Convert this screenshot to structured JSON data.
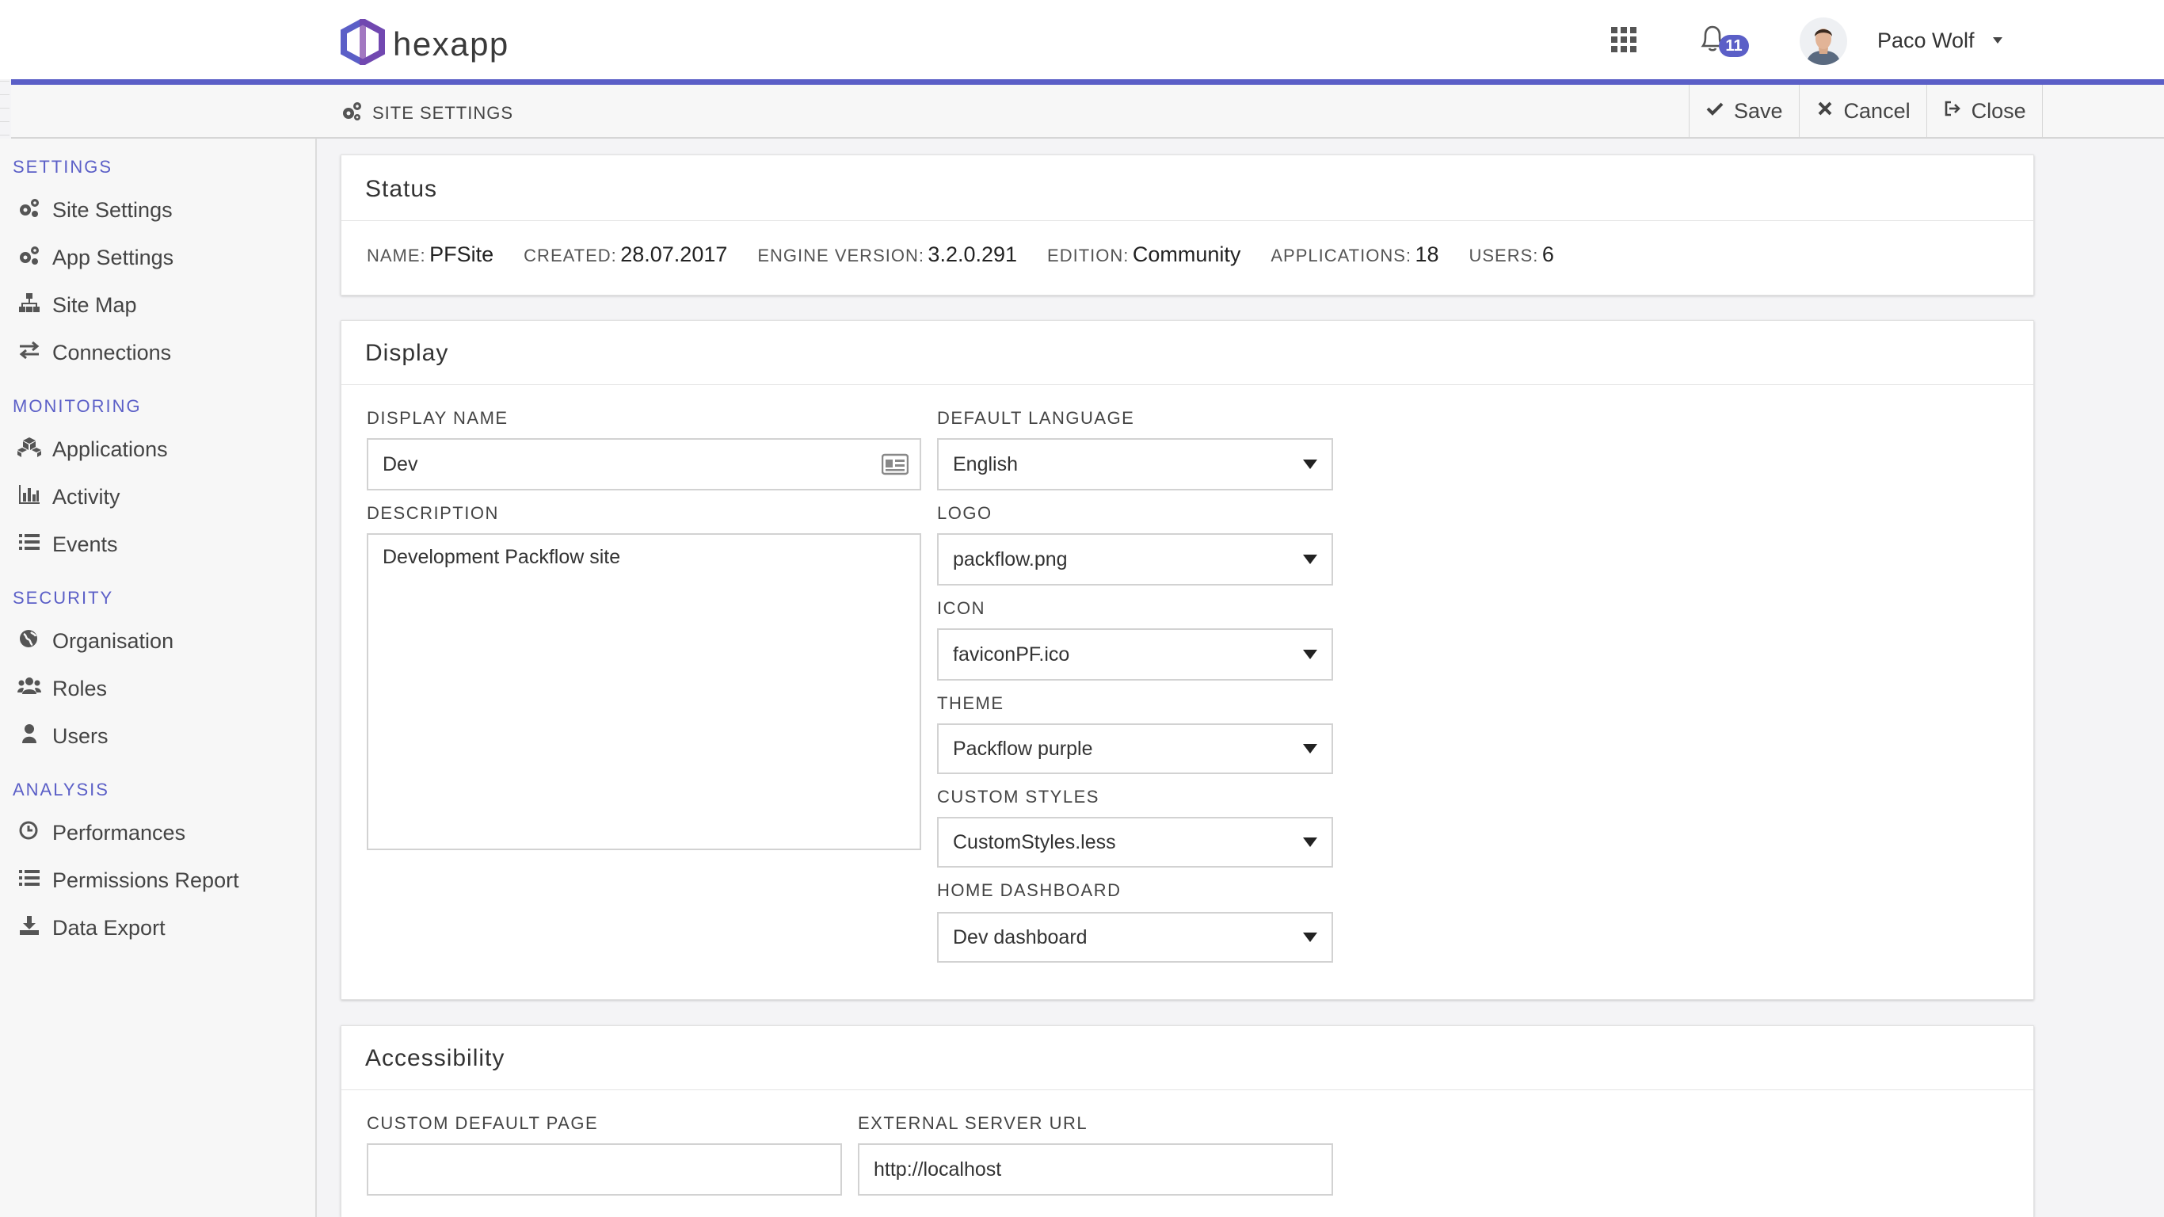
{
  "app": {
    "name": "hexapp"
  },
  "header": {
    "notifications_count": "11",
    "user_name": "Paco Wolf",
    "accent_color": "#5b5fc7"
  },
  "subbar": {
    "title": "SITE SETTINGS",
    "actions": {
      "save": "Save",
      "cancel": "Cancel",
      "close": "Close"
    }
  },
  "sidebar": {
    "sections": [
      {
        "title": "SETTINGS",
        "items": [
          {
            "label": "Site Settings",
            "icon": "gears-icon"
          },
          {
            "label": "App Settings",
            "icon": "gears-icon"
          },
          {
            "label": "Site Map",
            "icon": "sitemap-icon"
          },
          {
            "label": "Connections",
            "icon": "exchange-icon"
          }
        ]
      },
      {
        "title": "MONITORING",
        "items": [
          {
            "label": "Applications",
            "icon": "cubes-icon"
          },
          {
            "label": "Activity",
            "icon": "bar-chart-icon"
          },
          {
            "label": "Events",
            "icon": "list-icon"
          }
        ]
      },
      {
        "title": "SECURITY",
        "items": [
          {
            "label": "Organisation",
            "icon": "globe-icon"
          },
          {
            "label": "Roles",
            "icon": "users-icon"
          },
          {
            "label": "Users",
            "icon": "user-icon"
          }
        ]
      },
      {
        "title": "ANALYSIS",
        "items": [
          {
            "label": "Performances",
            "icon": "clock-icon"
          },
          {
            "label": "Permissions Report",
            "icon": "list-icon"
          },
          {
            "label": "Data Export",
            "icon": "download-icon"
          }
        ]
      }
    ]
  },
  "status": {
    "title": "Status",
    "name_label": "NAME:",
    "name_value": "PFSite",
    "created_label": "CREATED:",
    "created_value": "28.07.2017",
    "engine_label": "ENGINE VERSION:",
    "engine_value": "3.2.0.291",
    "edition_label": "EDITION:",
    "edition_value": "Community",
    "applications_label": "APPLICATIONS:",
    "applications_value": "18",
    "users_label": "USERS:",
    "users_value": "6"
  },
  "display": {
    "title": "Display",
    "display_name_label": "DISPLAY NAME",
    "display_name_value": "Dev",
    "description_label": "DESCRIPTION",
    "description_value": "Development Packflow site",
    "default_language_label": "DEFAULT LANGUAGE",
    "default_language_value": "English",
    "logo_label": "LOGO",
    "logo_value": "packflow.png",
    "icon_label": "ICON",
    "icon_value": "faviconPF.ico",
    "theme_label": "THEME",
    "theme_value": "Packflow purple",
    "custom_styles_label": "CUSTOM STYLES",
    "custom_styles_value": "CustomStyles.less",
    "home_dashboard_label": "HOME DASHBOARD",
    "home_dashboard_value": "Dev dashboard"
  },
  "accessibility": {
    "title": "Accessibility",
    "custom_default_page_label": "CUSTOM DEFAULT PAGE",
    "custom_default_page_value": "",
    "external_server_url_label": "EXTERNAL SERVER URL",
    "external_server_url_value": "http://localhost"
  }
}
